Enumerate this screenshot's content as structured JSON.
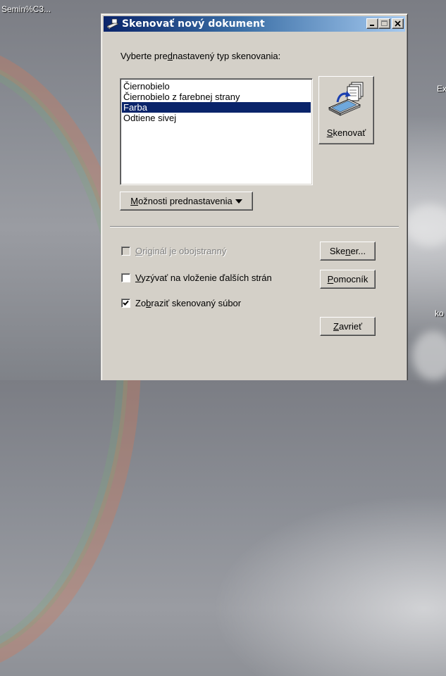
{
  "desktop": {
    "icon_label_top": "Semin%C3...",
    "icon_label_right_1": "Ex",
    "icon_label_right_2": "ko"
  },
  "dialog": {
    "title": "Skenovať nový dokument",
    "prompt_before": "Vyberte pre",
    "prompt_access": "d",
    "prompt_after": "nastavený typ skenovania:",
    "scan_types": [
      "Čiernobielo",
      "Čiernobielo z farebnej strany",
      "Farba",
      "Odtiene sivej"
    ],
    "selected_scan_type": "Farba",
    "scan_button": {
      "access": "S",
      "rest": "kenovať"
    },
    "options_button": {
      "access": "M",
      "rest": "ožnosti prednastavenia"
    },
    "options": [
      {
        "access": "O",
        "rest": "riginál je obojstranný",
        "checked": false,
        "enabled": false
      },
      {
        "access": "V",
        "rest": "yzývať na vloženie ďalších strán",
        "checked": false,
        "enabled": true
      },
      {
        "pre": "Zo",
        "access": "b",
        "rest": "raziť skenovaný súbor",
        "checked": true,
        "enabled": true
      }
    ],
    "scanner_button": {
      "pre": "Ske",
      "access": "n",
      "rest": "er..."
    },
    "help_button": {
      "access": "P",
      "rest": "omocník"
    },
    "close_button": {
      "access": "Z",
      "rest": "avrieť"
    }
  },
  "colors": {
    "selection": "#0a246a",
    "dialog_face": "#d4d0c8",
    "title_gradient_start": "#0a246a",
    "title_gradient_end": "#a6caf0"
  }
}
